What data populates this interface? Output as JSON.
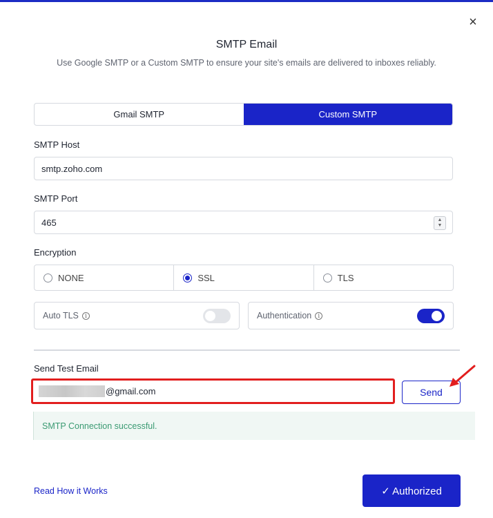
{
  "dialog": {
    "title": "SMTP Email",
    "subtitle": "Use Google SMTP or a Custom SMTP to ensure your site's emails are delivered to inboxes reliably.",
    "close_icon": "×"
  },
  "tabs": [
    {
      "label": "Gmail SMTP",
      "active": false
    },
    {
      "label": "Custom SMTP",
      "active": true
    }
  ],
  "smtp_host": {
    "label": "SMTP Host",
    "value": "smtp.zoho.com"
  },
  "smtp_port": {
    "label": "SMTP Port",
    "value": "465"
  },
  "encryption": {
    "label": "Encryption",
    "options": [
      {
        "label": "NONE",
        "checked": false
      },
      {
        "label": "SSL",
        "checked": true
      },
      {
        "label": "TLS",
        "checked": false
      }
    ]
  },
  "auto_tls": {
    "label": "Auto TLS",
    "info_icon": "i",
    "enabled": false
  },
  "authentication": {
    "label": "Authentication",
    "info_icon": "i",
    "enabled": true
  },
  "test_email": {
    "label": "Send Test Email",
    "value_suffix": "@gmail.com",
    "send_label": "Send"
  },
  "alert": {
    "message": "SMTP Connection successful."
  },
  "footer": {
    "link_label": "Read How it Works",
    "authorized_label": "✓ Authorized"
  },
  "colors": {
    "accent": "#1a24c8",
    "highlight": "#e21e1e",
    "success": "#3a9a72"
  }
}
